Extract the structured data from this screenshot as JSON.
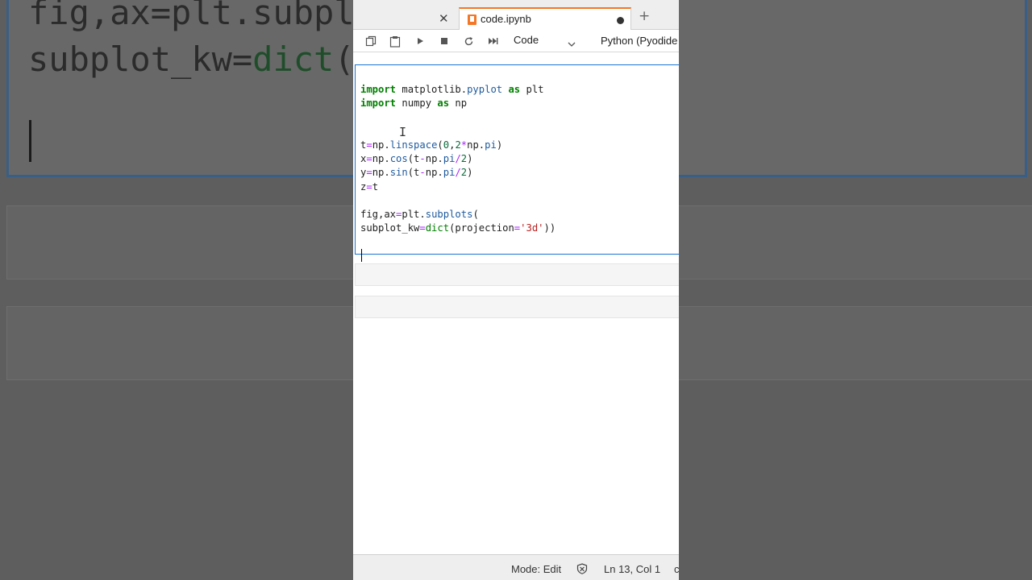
{
  "background": {
    "code_line_1": "fig,ax=plt.subplo",
    "code_line_2_pre": "subplot_kw=",
    "code_line_2_fn": "dict",
    "code_line_2_post": "(p"
  },
  "tabs": {
    "active_title": "code.ipynb",
    "accent_color": "#f37726"
  },
  "toolbar": {
    "cell_type": "Code",
    "kernel": "Python (Pyodide"
  },
  "code": {
    "l1_kw": "import",
    "l1_mod": " matplotlib.",
    "l1_attr": "pyplot",
    "l1_as": " as",
    "l1_name": " plt",
    "l2_kw": "import",
    "l2_mod": " numpy",
    "l2_as": " as",
    "l2_name": " np",
    "l4_a": "t",
    "l4_eq": "=",
    "l4_b": "np.",
    "l4_fn": "linspace",
    "l4_c": "(",
    "l4_n0": "0",
    "l4_d": ",",
    "l4_n2": "2",
    "l4_mul": "*",
    "l4_e": "np.",
    "l4_pi": "pi",
    "l4_f": ")",
    "l5_a": "x",
    "l5_eq": "=",
    "l5_b": "np.",
    "l5_fn": "cos",
    "l5_c": "(t",
    "l5_minus": "-",
    "l5_d": "np.",
    "l5_pi": "pi",
    "l5_div": "/",
    "l5_n": "2",
    "l5_e": ")",
    "l6_a": "y",
    "l6_eq": "=",
    "l6_b": "np.",
    "l6_fn": "sin",
    "l6_c": "(t",
    "l6_minus": "-",
    "l6_d": "np.",
    "l6_pi": "pi",
    "l6_div": "/",
    "l6_n": "2",
    "l6_e": ")",
    "l7_a": "z",
    "l7_eq": "=",
    "l7_b": "t",
    "l9_a": "fig,ax",
    "l9_eq": "=",
    "l9_b": "plt.",
    "l9_fn": "subplots",
    "l9_c": "(",
    "l10_a": "subplot_kw",
    "l10_eq": "=",
    "l10_fn": "dict",
    "l10_b": "(projection",
    "l10_eq2": "=",
    "l10_str": "'3d'",
    "l10_c": "))"
  },
  "status": {
    "mode": "Mode: Edit",
    "position": "Ln 13, Col 1",
    "more": "c"
  }
}
